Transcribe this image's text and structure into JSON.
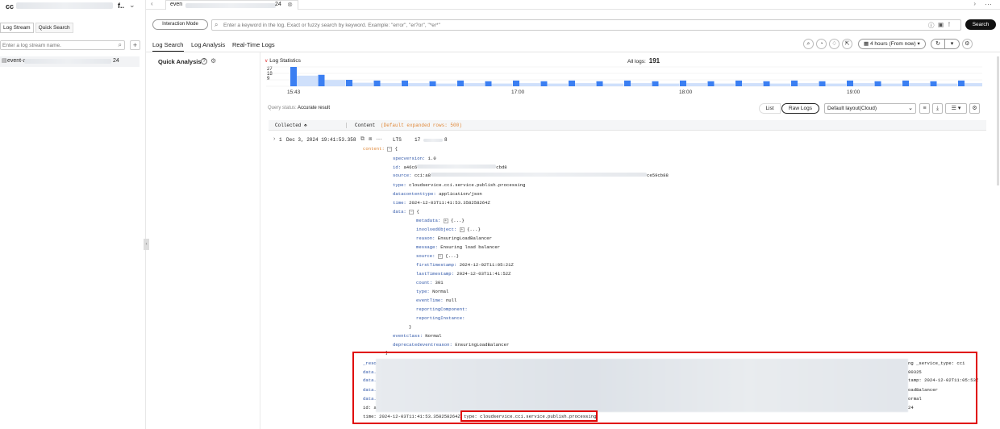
{
  "sidebar": {
    "title": "cc",
    "title_suffix": "f..",
    "tabs": [
      "Log Stream",
      "Quick Search"
    ],
    "search_placeholder": "Enter a log stream name.",
    "stream_prefix": "event-a",
    "stream_suffix": "24"
  },
  "tabbar": {
    "tab_prefix": "even",
    "tab_suffix": "24"
  },
  "query": {
    "mode_label": "Interaction Mode",
    "placeholder": "Enter a keyword in the log. Exact or fuzzy search by keyword. Example: \"error\", \"er?or\", \"*er*\"",
    "search_label": "Search"
  },
  "subtabs": [
    "Log Search",
    "Log Analysis",
    "Real-Time Logs"
  ],
  "time_range": "4 hours (From now)",
  "quick_analysis": "Quick Analysis",
  "stats": {
    "label": "Log Statistics",
    "all_logs_label": "All logs:",
    "all_logs_value": "191",
    "y_ticks": [
      "27",
      "18",
      "9"
    ],
    "x_ticks": [
      "15:43",
      "17:00",
      "18:00",
      "19:00"
    ]
  },
  "chart_data": {
    "type": "bar",
    "title": "Log Statistics",
    "x": [
      "15:43",
      "17:00",
      "18:00",
      "19:00"
    ],
    "values": [
      27,
      16,
      9,
      8,
      8,
      7,
      8,
      7,
      8,
      7,
      8,
      7,
      8,
      7,
      8,
      7,
      8,
      7,
      8,
      7,
      8,
      7,
      8,
      7,
      8,
      7
    ],
    "ylim": [
      0,
      27
    ]
  },
  "toolbar2": {
    "query_status_label": "Query status:",
    "query_status_value": "Accurate result",
    "view_list": "List",
    "view_raw": "Raw Logs",
    "layout": "Default layout(Cloud)"
  },
  "table": {
    "col_collected": "Collected",
    "col_content": "Content",
    "note": "(Default expanded rows: 500)"
  },
  "row": {
    "index": "1",
    "time": "Dec 3, 2024 19:41:53.358",
    "lts": "LTS",
    "n1": "17",
    "n2": "8"
  },
  "json": {
    "content_key": "content:",
    "brace_open": "{",
    "brace_close": "}",
    "specversion_k": "specversion:",
    "specversion_v": "1.0",
    "id_k": "id:",
    "id_v": "a46c6",
    "id_suffix": "cbd8",
    "source_k": "source:",
    "source_v": "cci:a8",
    "source_suffix": "ce59cb88",
    "type_k": "type:",
    "type_v": "cloudservice.cci.service.publish.processing",
    "dct_k": "datacontenttype:",
    "dct_v": "application/json",
    "time_k": "time:",
    "time_v": "2024-12-03T11:41:53.358258264Z",
    "data_k": "data:",
    "metadata_k": "metadata:",
    "ellipsis": "{...}",
    "involved_k": "involvedObject:",
    "reason_k": "reason:",
    "reason_v": "EnsuringLoadBalancer",
    "message_k": "message:",
    "message_v": "Ensuring load balancer",
    "src_k": "source:",
    "first_k": "firstTimestamp:",
    "first_v": "2024-12-02T11:05:21Z",
    "last_k": "lastTimestamp:",
    "last_v": "2024-12-03T11:41:52Z",
    "count_k": "count:",
    "count_v": "301",
    "typen_k": "type:",
    "typen_v": "Normal",
    "eventtime_k": "eventTime:",
    "eventtime_v": "null",
    "repcomp_k": "reportingComponent:",
    "repinst_k": "reportingInstance:",
    "eventclass_k": "eventclass:",
    "eventclass_v": "Normal",
    "deprecated_k": "deprecatedeventreason:",
    "deprecated_v": "EnsuringLoadBalancer"
  },
  "summary": {
    "l1_left": "_resource_",
    "l1_right": "ng _service_type: cci",
    "l2_left": "data.count",
    "l2_right": "00325",
    "l3_left": "data.invol",
    "l3_right": "tamp: 2024-12-02T11:05:53Z",
    "l4_left": "data.metad",
    "l4_right": "oadBalancer",
    "l5_left": "data.repor",
    "l5_right": "ormal",
    "l6_left": "id: a46c65",
    "l6_right": "24",
    "l7_time": "time: 2024-12-03T11:41:53.358258264Z",
    "l7_type": "type: cloudservice.cci.service.publish.processing"
  },
  "colors": {
    "accent": "#111111",
    "highlight": "#e00000",
    "bar": "#3b7ff2",
    "bar_light": "#cfe0fb",
    "key": "#2f56a8",
    "note": "#e0893a"
  }
}
